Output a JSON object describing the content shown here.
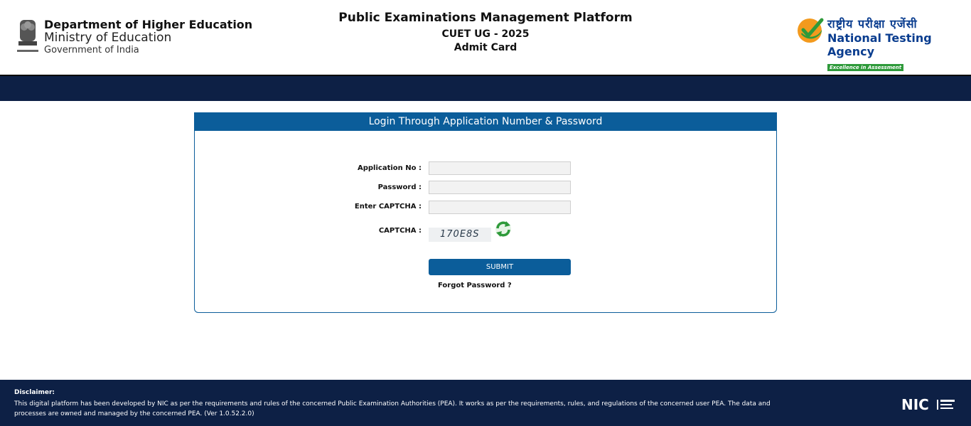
{
  "header": {
    "dept_line1": "Department of Higher Education",
    "dept_line2": "Ministry of Education",
    "dept_line3": "Government of India",
    "platform_title": "Public Examinations Management Platform",
    "exam_title": "CUET UG - 2025",
    "page_subtitle": "Admit Card",
    "nta_hindi": "राष्ट्रीय परीक्षा एजेंसी",
    "nta_english": "National Testing Agency",
    "nta_tagline": "Excellence in Assessment"
  },
  "login": {
    "panel_title": "Login Through Application Number & Password",
    "application_label": "Application No :",
    "application_value": "",
    "password_label": "Password :",
    "password_value": "",
    "enter_captcha_label": "Enter CAPTCHA :",
    "enter_captcha_value": "",
    "captcha_label": "CAPTCHA :",
    "captcha_text": "170E8S",
    "submit_label": "SUBMIT",
    "forgot_label": "Forgot Password ?"
  },
  "footer": {
    "disclaimer_title": "Disclaimer:",
    "disclaimer_text": "This digital platform has been developed by NIC as per the requirements and rules of the concerned Public Examination Authorities (PEA). It works as per the requirements, rules, and regulations of the concerned user PEA. The data and processes are owned and managed by the concerned PEA. (Ver 1.0.52.2.0)",
    "nic_logo_text": "NIC"
  },
  "colors": {
    "primary_blue": "#0b5d9a",
    "dark_navy": "#0d2045",
    "nta_green": "#2e9a3a",
    "nta_orange": "#f39a1e"
  },
  "icons": {
    "emblem": "national-emblem-icon",
    "nta": "nta-check-logo-icon",
    "refresh": "refresh-captcha-icon"
  }
}
